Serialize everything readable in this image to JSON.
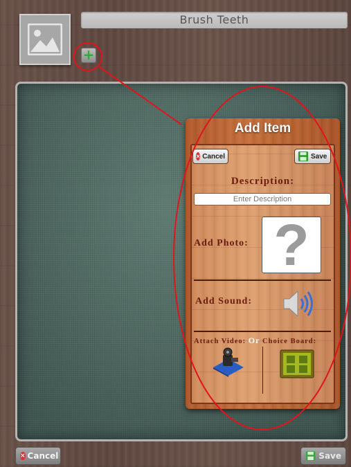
{
  "header": {
    "title": "Brush Teeth"
  },
  "footer": {
    "cancel_label": "Cancel",
    "save_label": "Save"
  },
  "dialog": {
    "title": "Add Item",
    "cancel_label": "Cancel",
    "save_label": "Save",
    "description_label": "Description:",
    "description_placeholder": "Enter Description",
    "add_photo_label": "Add Photo:",
    "add_sound_label": "Add Sound:",
    "attach_video_label": "Attach Video:",
    "or_label": "Or",
    "choice_board_label": "Choice Board:"
  },
  "icons": {
    "image_placeholder": "image-placeholder-icon",
    "add": "plus-icon",
    "cancel": "x-circle-icon",
    "save": "floppy-disk-icon",
    "question": "question-mark-icon",
    "sound": "speaker-icon",
    "video": "video-camera-icon",
    "choice_board": "grid-board-icon"
  },
  "colors": {
    "annotation": "#e0141c",
    "dialog_wood": "#c66f3b",
    "label_text": "#6a1c0c",
    "board": "#4e6962"
  }
}
